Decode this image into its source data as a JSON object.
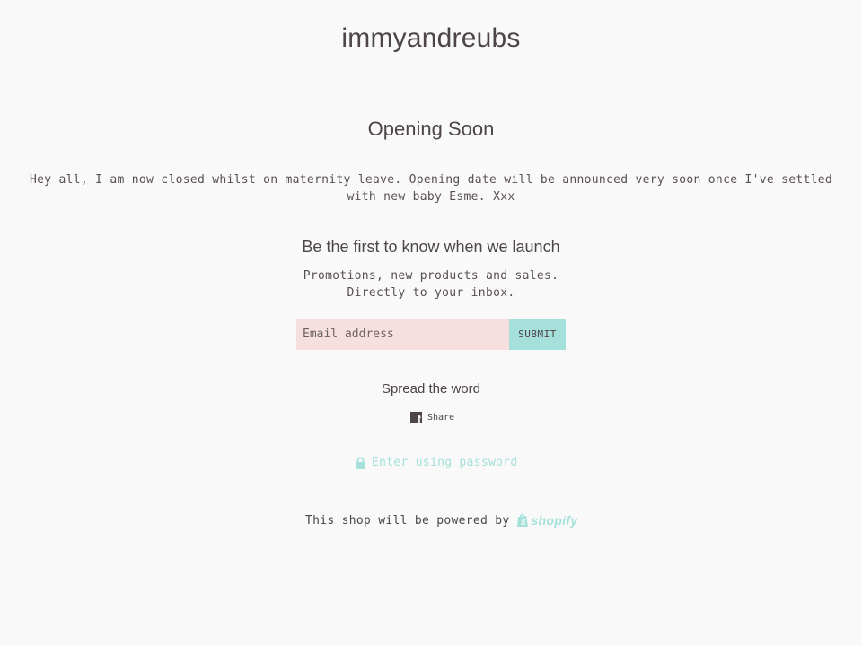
{
  "shop": {
    "name": "immyandreubs"
  },
  "main": {
    "title": "Opening Soon",
    "message": "Hey all, I am now closed whilst on maternity leave. Opening date will be announced very soon once I've settled with new baby Esme. Xxx"
  },
  "newsletter": {
    "heading": "Be the first to know when we launch",
    "line1": "Promotions, new products and sales.",
    "line2": "Directly to your inbox.",
    "email_placeholder": "Email address",
    "email_value": "",
    "submit_label": "SUBMIT"
  },
  "social": {
    "heading": "Spread the word",
    "share_label": "Share",
    "share_icon": "facebook-icon"
  },
  "password": {
    "label": "Enter using password",
    "icon": "lock-icon"
  },
  "footer": {
    "powered_text": "This shop will be powered by",
    "brand": "shopify",
    "brand_icon": "shopify-bag-icon"
  },
  "colors": {
    "background": "#f9f9f9",
    "text": "#4d4546",
    "accent": "#a5e0da",
    "input_bg": "#f8dfdf"
  }
}
